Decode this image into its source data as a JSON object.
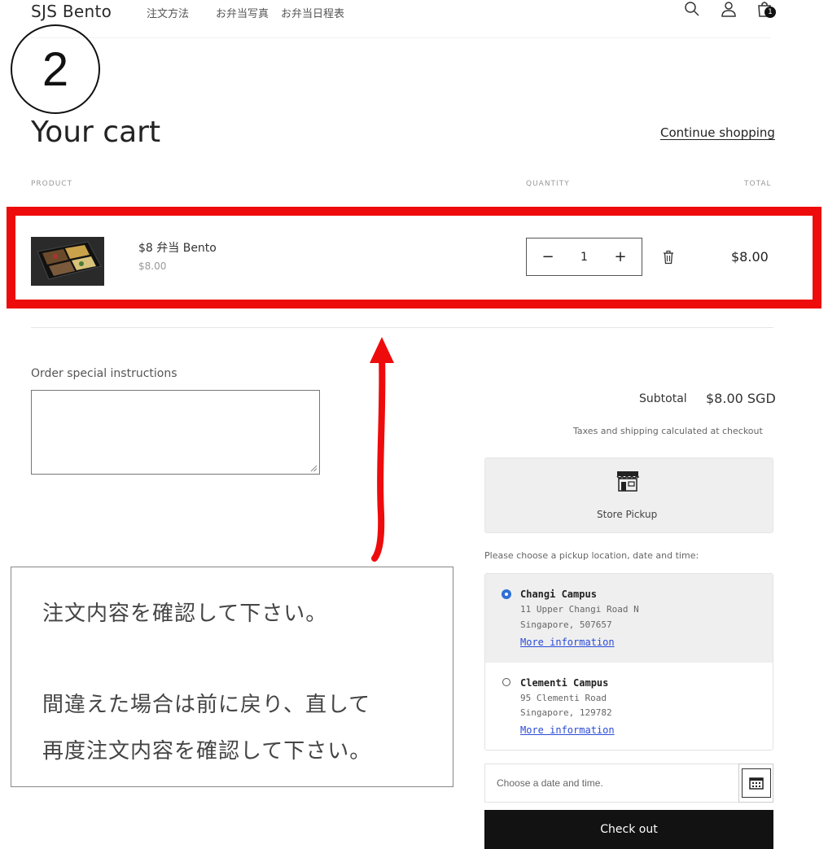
{
  "header": {
    "brand": "SJS Bento",
    "nav": [
      "注文方法",
      "お弁当写真",
      "お弁当日程表"
    ],
    "cart_count": "1",
    "icons": [
      "search-icon",
      "account-icon",
      "cart-icon"
    ]
  },
  "step_number": "2",
  "cart": {
    "title": "Your cart",
    "continue_label": "Continue shopping",
    "columns": {
      "product": "PRODUCT",
      "quantity": "QUANTITY",
      "total": "TOTAL"
    },
    "item": {
      "name": "$8 弁当 Bento",
      "price": "$8.00",
      "quantity": "1",
      "line_total": "$8.00"
    }
  },
  "instructions": {
    "label": "Order special instructions"
  },
  "summary": {
    "subtotal_label": "Subtotal",
    "subtotal_value": "$8.00 SGD",
    "tax_note": "Taxes and shipping calculated at checkout"
  },
  "pickup": {
    "method_label": "Store Pickup",
    "prompt": "Please choose a pickup location, date and time:",
    "locations": [
      {
        "name": "Changi Campus",
        "line1": "11 Upper Changi Road N",
        "line2": "Singapore, 507657",
        "link": "More information",
        "selected": true
      },
      {
        "name": "Clementi Campus",
        "line1": "95 Clementi Road",
        "line2": "Singapore, 129782",
        "link": "More information",
        "selected": false
      }
    ],
    "date_placeholder": "Choose a date and time."
  },
  "checkout_label": "Check out",
  "annotation": {
    "line1": "注文内容を確認して下さい。",
    "line2": "間違えた場合は前に戻り、直して",
    "line3": "再度注文内容を確認して下さい。"
  },
  "colors": {
    "highlight": "#ee0b0b",
    "link": "#2a4bd7",
    "radio": "#2f6fd6",
    "checkout_bg": "#121212"
  }
}
